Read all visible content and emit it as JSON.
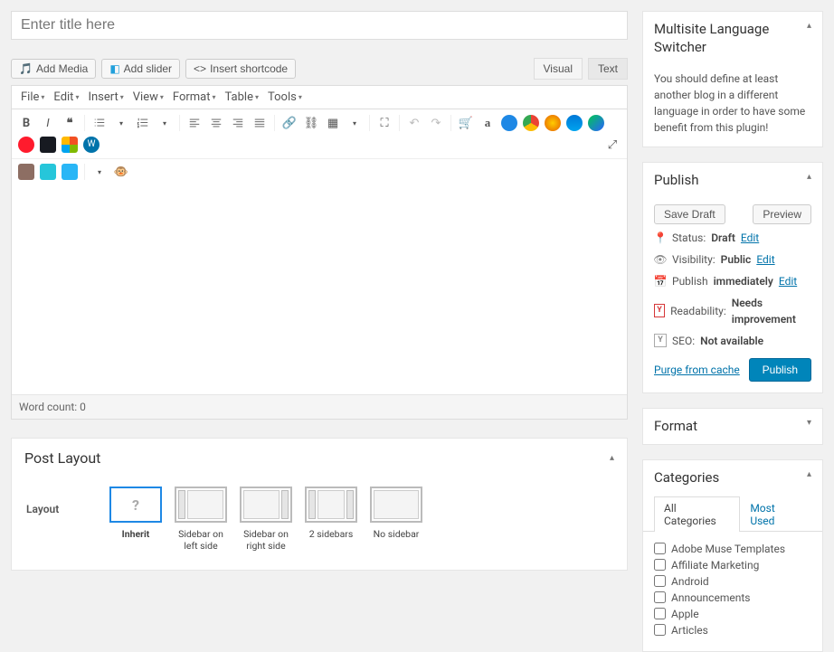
{
  "title_placeholder": "Enter title here",
  "editor_top": {
    "add_media": "Add Media",
    "add_slider": "Add slider",
    "insert_shortcode": "Insert shortcode",
    "visual_tab": "Visual",
    "text_tab": "Text"
  },
  "editor_menu": {
    "file": "File",
    "edit": "Edit",
    "insert": "Insert",
    "view": "View",
    "format": "Format",
    "table": "Table",
    "tools": "Tools"
  },
  "word_count": "Word count: 0",
  "post_layout": {
    "heading": "Post Layout",
    "label": "Layout",
    "options": {
      "inherit": "Inherit",
      "sidebar_left": "Sidebar on left side",
      "sidebar_right": "Sidebar on right side",
      "two_sidebars": "2 sidebars",
      "no_sidebar": "No sidebar"
    }
  },
  "sidebar": {
    "language": {
      "heading": "Multisite Language Switcher",
      "desc": "You should define at least another blog in a different language in order to have some benefit from this plugin!"
    },
    "publish": {
      "heading": "Publish",
      "save_draft": "Save Draft",
      "preview": "Preview",
      "status_label": "Status:",
      "status_value": "Draft",
      "visibility_label": "Visibility:",
      "visibility_value": "Public",
      "publish_label": "Publish",
      "publish_value": "immediately",
      "readability_label": "Readability:",
      "readability_value": "Needs improvement",
      "seo_label": "SEO:",
      "seo_value": "Not available",
      "edit": "Edit",
      "purge": "Purge from cache",
      "publish_btn": "Publish"
    },
    "format": {
      "heading": "Format"
    },
    "categories": {
      "heading": "Categories",
      "tab_all": "All Categories",
      "tab_used": "Most Used",
      "items": [
        "Adobe Muse Templates",
        "Affiliate Marketing",
        "Android",
        "Announcements",
        "Apple",
        "Articles"
      ]
    }
  }
}
